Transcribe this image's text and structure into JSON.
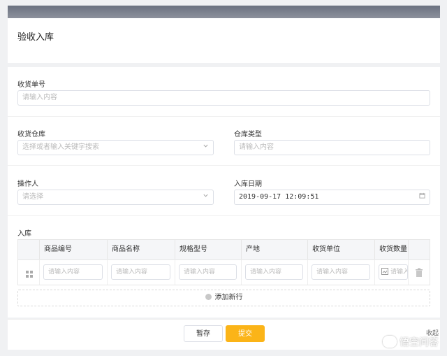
{
  "page": {
    "title": "验收入库"
  },
  "form": {
    "receipt_no": {
      "label": "收货单号",
      "placeholder": "请输入内容"
    },
    "warehouse": {
      "label": "收货仓库",
      "placeholder": "选择或者输入关键字搜索"
    },
    "warehouse_type": {
      "label": "仓库类型",
      "placeholder": "请输入内容"
    },
    "operator": {
      "label": "操作人",
      "placeholder": "请选择"
    },
    "date": {
      "label": "入库日期",
      "value": "2019-09-17 12:09:51"
    }
  },
  "table": {
    "section_label": "入库",
    "columns": [
      "商品编号",
      "商品名称",
      "规格型号",
      "产地",
      "收货单位",
      "收货数量"
    ],
    "cell_placeholder": "请输入内容",
    "add_row_label": "添加新行"
  },
  "footer": {
    "save_label": "暂存",
    "submit_label": "提交",
    "collapse_label": "收起"
  },
  "watermark": {
    "text": "悟空问答"
  },
  "colors": {
    "accent": "#fbb418",
    "topbar": "#767b87"
  },
  "icons": [
    "chevron-down-icon",
    "calendar-icon",
    "drag-handle-icon",
    "trash-icon",
    "plus-circle-icon",
    "image-icon"
  ]
}
